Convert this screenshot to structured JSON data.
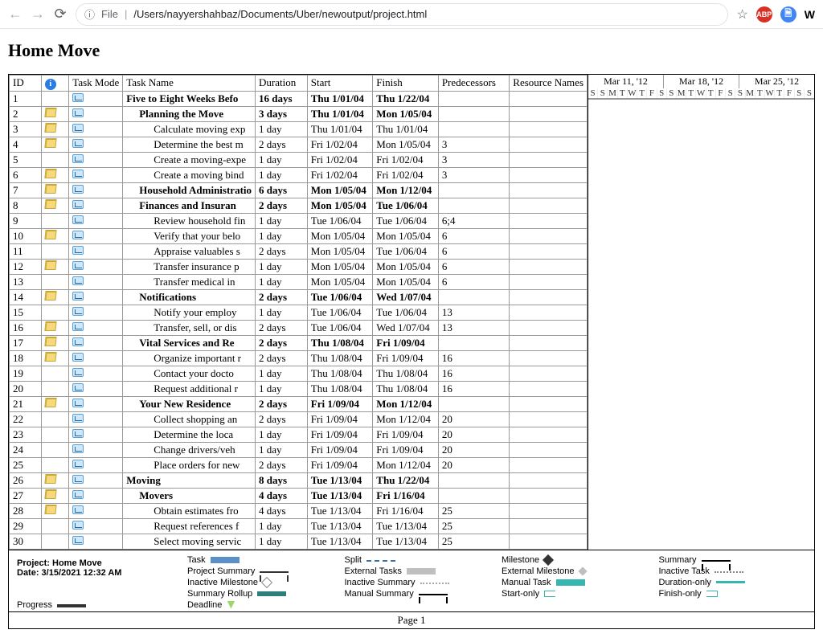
{
  "browser": {
    "scheme_icon": "ⓘ",
    "file_label": "File",
    "path": "/Users/nayyershahbaz/Documents/Uber/newoutput/project.html",
    "star": "☆",
    "abp": "ABP",
    "w": "W"
  },
  "title": "Home Move",
  "columns": {
    "id": "ID",
    "info": "i",
    "mode": "Task Mode",
    "task": "Task Name",
    "duration": "Duration",
    "start": "Start",
    "finish": "Finish",
    "pred": "Predecessors",
    "res": "Resource Names"
  },
  "timeline": {
    "groups": [
      "Mar 11, '12",
      "Mar 18, '12",
      "Mar 25, '12"
    ],
    "days": [
      "S",
      "S",
      "M",
      "T",
      "W",
      "T",
      "F",
      "S",
      "S",
      "M",
      "T",
      "W",
      "T",
      "F",
      "S",
      "S",
      "M",
      "T",
      "W",
      "T",
      "F",
      "S",
      "S"
    ]
  },
  "rows": [
    {
      "id": "1",
      "note": false,
      "indent": 0,
      "bold": true,
      "task": "Five to Eight Weeks Befo",
      "dur": "16 days",
      "start": "Thu 1/01/04",
      "finish": "Thu 1/22/04",
      "pred": ""
    },
    {
      "id": "2",
      "note": true,
      "indent": 1,
      "bold": true,
      "task": "Planning the Move",
      "dur": "3 days",
      "start": "Thu 1/01/04",
      "finish": "Mon 1/05/04",
      "pred": ""
    },
    {
      "id": "3",
      "note": true,
      "indent": 2,
      "bold": false,
      "task": "Calculate moving exp",
      "dur": "1 day",
      "start": "Thu 1/01/04",
      "finish": "Thu 1/01/04",
      "pred": ""
    },
    {
      "id": "4",
      "note": true,
      "indent": 2,
      "bold": false,
      "task": "Determine the best m",
      "dur": "2 days",
      "start": "Fri 1/02/04",
      "finish": "Mon 1/05/04",
      "pred": "3"
    },
    {
      "id": "5",
      "note": false,
      "indent": 2,
      "bold": false,
      "task": "Create a moving-expe",
      "dur": "1 day",
      "start": "Fri 1/02/04",
      "finish": "Fri 1/02/04",
      "pred": "3"
    },
    {
      "id": "6",
      "note": true,
      "indent": 2,
      "bold": false,
      "task": "Create a moving bind",
      "dur": "1 day",
      "start": "Fri 1/02/04",
      "finish": "Fri 1/02/04",
      "pred": "3"
    },
    {
      "id": "7",
      "note": true,
      "indent": 1,
      "bold": true,
      "task": "Household Administratio",
      "dur": "6 days",
      "start": "Mon 1/05/04",
      "finish": "Mon 1/12/04",
      "pred": ""
    },
    {
      "id": "8",
      "note": true,
      "indent": 1,
      "bold": true,
      "task": "Finances and Insuran",
      "dur": "2 days",
      "start": "Mon 1/05/04",
      "finish": "Tue 1/06/04",
      "pred": ""
    },
    {
      "id": "9",
      "note": false,
      "indent": 2,
      "bold": false,
      "task": "Review household fin",
      "dur": "1 day",
      "start": "Tue 1/06/04",
      "finish": "Tue 1/06/04",
      "pred": "6;4"
    },
    {
      "id": "10",
      "note": true,
      "indent": 2,
      "bold": false,
      "task": "Verify that your belo",
      "dur": "1 day",
      "start": "Mon 1/05/04",
      "finish": "Mon 1/05/04",
      "pred": "6"
    },
    {
      "id": "11",
      "note": false,
      "indent": 2,
      "bold": false,
      "task": "Appraise valuables s",
      "dur": "2 days",
      "start": "Mon 1/05/04",
      "finish": "Tue 1/06/04",
      "pred": "6"
    },
    {
      "id": "12",
      "note": true,
      "indent": 2,
      "bold": false,
      "task": "Transfer insurance p",
      "dur": "1 day",
      "start": "Mon 1/05/04",
      "finish": "Mon 1/05/04",
      "pred": "6"
    },
    {
      "id": "13",
      "note": false,
      "indent": 2,
      "bold": false,
      "task": "Transfer medical in",
      "dur": "1 day",
      "start": "Mon 1/05/04",
      "finish": "Mon 1/05/04",
      "pred": "6"
    },
    {
      "id": "14",
      "note": true,
      "indent": 1,
      "bold": true,
      "task": "Notifications",
      "dur": "2 days",
      "start": "Tue 1/06/04",
      "finish": "Wed 1/07/04",
      "pred": ""
    },
    {
      "id": "15",
      "note": false,
      "indent": 2,
      "bold": false,
      "task": "Notify your employ",
      "dur": "1 day",
      "start": "Tue 1/06/04",
      "finish": "Tue 1/06/04",
      "pred": "13"
    },
    {
      "id": "16",
      "note": true,
      "indent": 2,
      "bold": false,
      "task": "Transfer, sell, or dis",
      "dur": "2 days",
      "start": "Tue 1/06/04",
      "finish": "Wed 1/07/04",
      "pred": "13"
    },
    {
      "id": "17",
      "note": true,
      "indent": 1,
      "bold": true,
      "task": "Vital Services and Re",
      "dur": "2 days",
      "start": "Thu 1/08/04",
      "finish": "Fri 1/09/04",
      "pred": ""
    },
    {
      "id": "18",
      "note": true,
      "indent": 2,
      "bold": false,
      "task": "Organize important r",
      "dur": "2 days",
      "start": "Thu 1/08/04",
      "finish": "Fri 1/09/04",
      "pred": "16"
    },
    {
      "id": "19",
      "note": false,
      "indent": 2,
      "bold": false,
      "task": "Contact your docto",
      "dur": "1 day",
      "start": "Thu 1/08/04",
      "finish": "Thu 1/08/04",
      "pred": "16"
    },
    {
      "id": "20",
      "note": false,
      "indent": 2,
      "bold": false,
      "task": "Request additional r",
      "dur": "1 day",
      "start": "Thu 1/08/04",
      "finish": "Thu 1/08/04",
      "pred": "16"
    },
    {
      "id": "21",
      "note": true,
      "indent": 1,
      "bold": true,
      "task": "Your New Residence",
      "dur": "2 days",
      "start": "Fri 1/09/04",
      "finish": "Mon 1/12/04",
      "pred": ""
    },
    {
      "id": "22",
      "note": false,
      "indent": 2,
      "bold": false,
      "task": "Collect shopping an",
      "dur": "2 days",
      "start": "Fri 1/09/04",
      "finish": "Mon 1/12/04",
      "pred": "20"
    },
    {
      "id": "23",
      "note": false,
      "indent": 2,
      "bold": false,
      "task": "Determine the loca",
      "dur": "1 day",
      "start": "Fri 1/09/04",
      "finish": "Fri 1/09/04",
      "pred": "20"
    },
    {
      "id": "24",
      "note": false,
      "indent": 2,
      "bold": false,
      "task": "Change drivers/veh",
      "dur": "1 day",
      "start": "Fri 1/09/04",
      "finish": "Fri 1/09/04",
      "pred": "20"
    },
    {
      "id": "25",
      "note": false,
      "indent": 2,
      "bold": false,
      "task": "Place orders for new",
      "dur": "2 days",
      "start": "Fri 1/09/04",
      "finish": "Mon 1/12/04",
      "pred": "20"
    },
    {
      "id": "26",
      "note": true,
      "indent": 0,
      "bold": true,
      "task": "Moving",
      "dur": "8 days",
      "start": "Tue 1/13/04",
      "finish": "Thu 1/22/04",
      "pred": ""
    },
    {
      "id": "27",
      "note": true,
      "indent": 1,
      "bold": true,
      "task": "Movers",
      "dur": "4 days",
      "start": "Tue 1/13/04",
      "finish": "Fri 1/16/04",
      "pred": ""
    },
    {
      "id": "28",
      "note": true,
      "indent": 2,
      "bold": false,
      "task": "Obtain estimates fro",
      "dur": "4 days",
      "start": "Tue 1/13/04",
      "finish": "Fri 1/16/04",
      "pred": "25"
    },
    {
      "id": "29",
      "note": false,
      "indent": 2,
      "bold": false,
      "task": "Request references f",
      "dur": "1 day",
      "start": "Tue 1/13/04",
      "finish": "Tue 1/13/04",
      "pred": "25"
    },
    {
      "id": "30",
      "note": false,
      "indent": 2,
      "bold": false,
      "task": "Select moving servic",
      "dur": "1 day",
      "start": "Tue 1/13/04",
      "finish": "Tue 1/13/04",
      "pred": "25"
    }
  ],
  "legend": {
    "project_label": "Project: Home Move",
    "date_label": "Date: 3/15/2021 12:32 AM",
    "items": {
      "task": "Task",
      "ext": "External Tasks",
      "man": "Manual Task",
      "finonly": "Finish-only",
      "split": "Split",
      "extm": "External Milestone",
      "duronly": "Duration-only",
      "prog": "Progress",
      "mile": "Milestone",
      "inact": "Inactive Task",
      "roll": "Summary Rollup",
      "dead": "Deadline",
      "sum": "Summary",
      "imile": "Inactive Milestone",
      "msum": "Manual Summary",
      "projsum": "Project Summary",
      "inactsum": "Inactive Summary",
      "startonly": "Start-only"
    }
  },
  "footer": "Page 1"
}
